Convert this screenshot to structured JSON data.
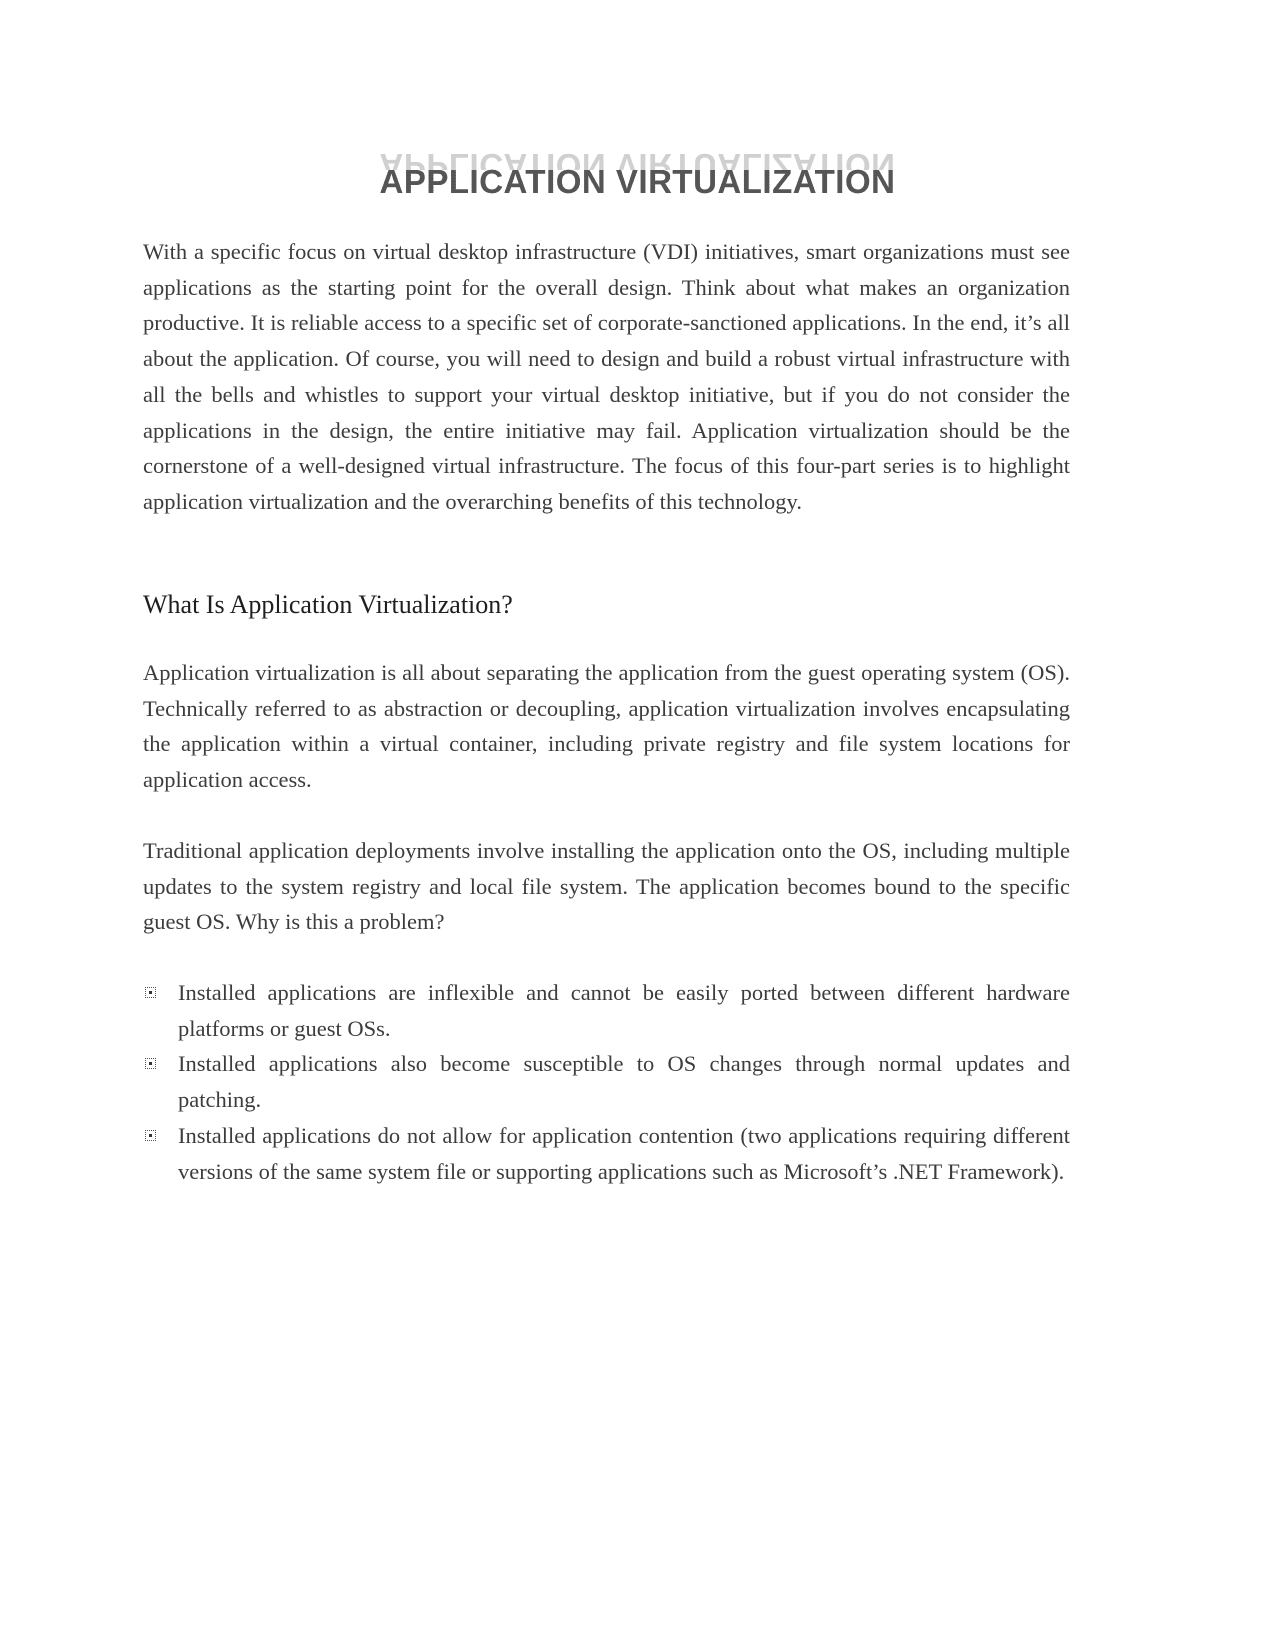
{
  "document": {
    "title": "APPLICATION VIRTUALIZATION",
    "intro_paragraph": "With a specific focus on virtual desktop infrastructure (VDI) initiatives, smart organizations must see applications as the starting point for the overall design. Think about what makes an organization productive. It is reliable access to a specific set of corporate-sanctioned applications. In the end, it’s all about the application. Of course, you will need to design and build a robust virtual infrastructure with all the bells and whistles to support your virtual desktop initiative, but if you do not consider the applications in the design, the entire initiative may fail. Application virtualization should be the cornerstone of a well-designed virtual infrastructure. The focus of this four-part series is to highlight application virtualization and the overarching benefits of this technology.",
    "section": {
      "heading": "What Is Application Virtualization?",
      "paragraphs": [
        "Application virtualization is all about separating the application from the guest operating system (OS). Technically referred to as abstraction or decoupling, application virtualization involves encapsulating the application within a virtual container, including private registry and file system locations for application access.",
        "Traditional application deployments involve installing the application onto the OS, including multiple updates to the system registry and local file system. The application becomes bound to the specific guest OS. Why is this a problem?"
      ],
      "bullets": [
        {
          "icon": "square-bullet-icon",
          "text": "Installed applications are inflexible and cannot be easily ported between different hardware platforms or guest OSs."
        },
        {
          "icon": "square-bullet-icon",
          "text": "Installed applications also become susceptible to OS changes through normal updates and patching."
        },
        {
          "icon": "square-bullet-icon",
          "text": "Installed applications do not allow for application contention (two applications requiring different versions of the same system file or supporting applications such as Microsoft’s .NET Framework)."
        }
      ]
    }
  }
}
